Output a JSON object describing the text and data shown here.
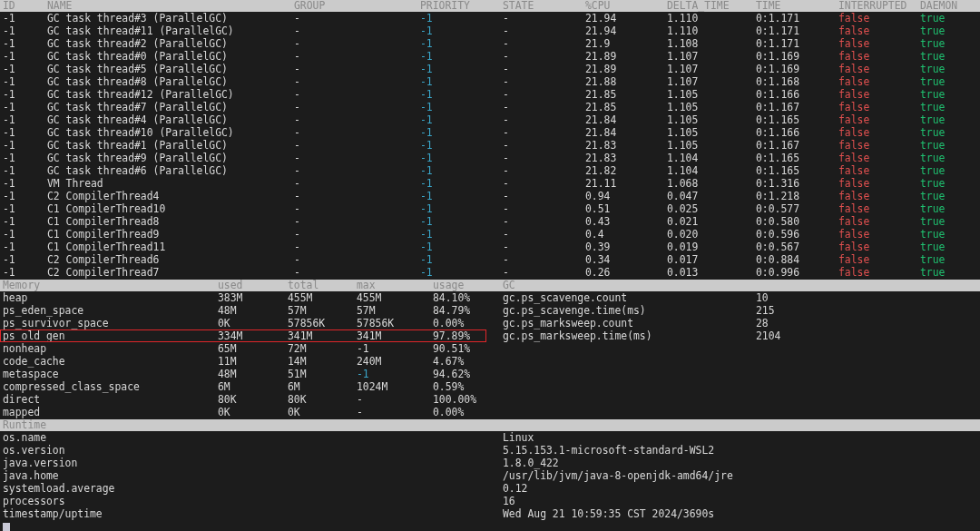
{
  "threads": {
    "columns": [
      "ID",
      "NAME",
      "GROUP",
      "PRIORITY",
      "STATE",
      "%CPU",
      "DELTA_TIME",
      "TIME",
      "INTERRUPTED",
      "DAEMON"
    ],
    "rows": [
      [
        "-1",
        "GC task thread#3 (ParallelGC)",
        "-",
        "-1",
        "-",
        "21.94",
        "1.110",
        "0:1.171",
        "false",
        "true"
      ],
      [
        "-1",
        "GC task thread#11 (ParallelGC)",
        "-",
        "-1",
        "-",
        "21.94",
        "1.110",
        "0:1.171",
        "false",
        "true"
      ],
      [
        "-1",
        "GC task thread#2 (ParallelGC)",
        "-",
        "-1",
        "-",
        "21.9",
        "1.108",
        "0:1.171",
        "false",
        "true"
      ],
      [
        "-1",
        "GC task thread#0 (ParallelGC)",
        "-",
        "-1",
        "-",
        "21.89",
        "1.107",
        "0:1.169",
        "false",
        "true"
      ],
      [
        "-1",
        "GC task thread#5 (ParallelGC)",
        "-",
        "-1",
        "-",
        "21.89",
        "1.107",
        "0:1.169",
        "false",
        "true"
      ],
      [
        "-1",
        "GC task thread#8 (ParallelGC)",
        "-",
        "-1",
        "-",
        "21.88",
        "1.107",
        "0:1.168",
        "false",
        "true"
      ],
      [
        "-1",
        "GC task thread#12 (ParallelGC)",
        "-",
        "-1",
        "-",
        "21.85",
        "1.105",
        "0:1.166",
        "false",
        "true"
      ],
      [
        "-1",
        "GC task thread#7 (ParallelGC)",
        "-",
        "-1",
        "-",
        "21.85",
        "1.105",
        "0:1.167",
        "false",
        "true"
      ],
      [
        "-1",
        "GC task thread#4 (ParallelGC)",
        "-",
        "-1",
        "-",
        "21.84",
        "1.105",
        "0:1.165",
        "false",
        "true"
      ],
      [
        "-1",
        "GC task thread#10 (ParallelGC)",
        "-",
        "-1",
        "-",
        "21.84",
        "1.105",
        "0:1.166",
        "false",
        "true"
      ],
      [
        "-1",
        "GC task thread#1 (ParallelGC)",
        "-",
        "-1",
        "-",
        "21.83",
        "1.105",
        "0:1.167",
        "false",
        "true"
      ],
      [
        "-1",
        "GC task thread#9 (ParallelGC)",
        "-",
        "-1",
        "-",
        "21.83",
        "1.104",
        "0:1.165",
        "false",
        "true"
      ],
      [
        "-1",
        "GC task thread#6 (ParallelGC)",
        "-",
        "-1",
        "-",
        "21.82",
        "1.104",
        "0:1.165",
        "false",
        "true"
      ],
      [
        "-1",
        "VM Thread",
        "-",
        "-1",
        "-",
        "21.11",
        "1.068",
        "0:1.316",
        "false",
        "true"
      ],
      [
        "-1",
        "C2 CompilerThread4",
        "-",
        "-1",
        "-",
        "0.94",
        "0.047",
        "0:1.218",
        "false",
        "true"
      ],
      [
        "-1",
        "C1 CompilerThread10",
        "-",
        "-1",
        "-",
        "0.51",
        "0.025",
        "0:0.577",
        "false",
        "true"
      ],
      [
        "-1",
        "C1 CompilerThread8",
        "-",
        "-1",
        "-",
        "0.43",
        "0.021",
        "0:0.580",
        "false",
        "true"
      ],
      [
        "-1",
        "C1 CompilerThread9",
        "-",
        "-1",
        "-",
        "0.4",
        "0.020",
        "0:0.596",
        "false",
        "true"
      ],
      [
        "-1",
        "C1 CompilerThread11",
        "-",
        "-1",
        "-",
        "0.39",
        "0.019",
        "0:0.567",
        "false",
        "true"
      ],
      [
        "-1",
        "C2 CompilerThread6",
        "-",
        "-1",
        "-",
        "0.34",
        "0.017",
        "0:0.884",
        "false",
        "true"
      ],
      [
        "-1",
        "C2 CompilerThread7",
        "-",
        "-1",
        "-",
        "0.26",
        "0.013",
        "0:0.996",
        "false",
        "true"
      ]
    ]
  },
  "memory": {
    "columns": [
      "Memory",
      "used",
      "total",
      "max",
      "usage"
    ],
    "rows": [
      {
        "name": "heap",
        "used": "383M",
        "total": "455M",
        "max": "455M",
        "usage": "84.10%",
        "highlighted": false,
        "max_accent": false
      },
      {
        "name": "ps_eden_space",
        "used": "48M",
        "total": "57M",
        "max": "57M",
        "usage": "84.79%",
        "highlighted": false,
        "max_accent": false
      },
      {
        "name": "ps_survivor_space",
        "used": "0K",
        "total": "57856K",
        "max": "57856K",
        "usage": "0.00%",
        "highlighted": false,
        "max_accent": false
      },
      {
        "name": "ps_old_gen",
        "used": "334M",
        "total": "341M",
        "max": "341M",
        "usage": "97.89%",
        "highlighted": true,
        "max_accent": false
      },
      {
        "name": "nonheap",
        "used": "65M",
        "total": "72M",
        "max": "-1",
        "usage": "90.51%",
        "highlighted": false,
        "max_accent": false
      },
      {
        "name": "code_cache",
        "used": "11M",
        "total": "14M",
        "max": "240M",
        "usage": "4.67%",
        "highlighted": false,
        "max_accent": false
      },
      {
        "name": "metaspace",
        "used": "48M",
        "total": "51M",
        "max": "-1",
        "usage": "94.62%",
        "highlighted": false,
        "max_accent": true
      },
      {
        "name": "compressed_class_space",
        "used": "6M",
        "total": "6M",
        "max": "1024M",
        "usage": "0.59%",
        "highlighted": false,
        "max_accent": false
      },
      {
        "name": "direct",
        "used": "80K",
        "total": "80K",
        "max": "-",
        "usage": "100.00%",
        "highlighted": false,
        "max_accent": false
      },
      {
        "name": "mapped",
        "used": "0K",
        "total": "0K",
        "max": "-",
        "usage": "0.00%",
        "highlighted": false,
        "max_accent": false
      }
    ]
  },
  "gc": {
    "title": "GC",
    "items": [
      {
        "name": "gc.ps_scavenge.count",
        "value": "10"
      },
      {
        "name": "gc.ps_scavenge.time(ms)",
        "value": "215"
      },
      {
        "name": "gc.ps_marksweep.count",
        "value": "28"
      },
      {
        "name": "gc.ps_marksweep.time(ms)",
        "value": "2104"
      }
    ]
  },
  "runtime": {
    "title": "Runtime",
    "items": [
      {
        "name": "os.name",
        "value": "Linux"
      },
      {
        "name": "os.version",
        "value": "5.15.153.1-microsoft-standard-WSL2"
      },
      {
        "name": "java.version",
        "value": "1.8.0_422"
      },
      {
        "name": "java.home",
        "value": "/usr/lib/jvm/java-8-openjdk-amd64/jre"
      },
      {
        "name": "systemload.average",
        "value": "0.12"
      },
      {
        "name": "processors",
        "value": "16"
      },
      {
        "name": "timestamp/uptime",
        "value": "Wed Aug 21 10:59:35 CST 2024/3690s"
      }
    ]
  }
}
